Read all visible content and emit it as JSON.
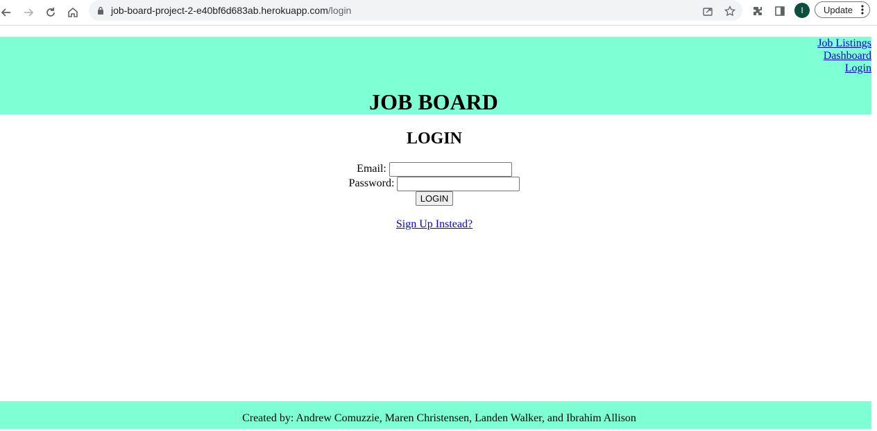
{
  "browser": {
    "url_host": "job-board-project-2-e40bf6d683ab.herokuapp.com",
    "url_path": "/login",
    "profile_initial": "I",
    "update_label": "Update"
  },
  "header": {
    "nav": {
      "job_listings": "Job Listings",
      "dashboard": "Dashboard",
      "login": "Login"
    },
    "title": "JOB BOARD"
  },
  "login": {
    "heading": "LOGIN",
    "email_label": "Email:",
    "email_value": "",
    "password_label": "Password:",
    "password_value": "",
    "submit_label": "LOGIN",
    "signup_link": "Sign Up Instead?"
  },
  "footer": {
    "credits": "Created by: Andrew Comuzzie, Maren Christensen, Landen Walker, and Ibrahim Allison"
  },
  "colors": {
    "header_bg": "#7fffd4",
    "link": "#0000ee",
    "avatar_bg": "#0b4f3c"
  }
}
